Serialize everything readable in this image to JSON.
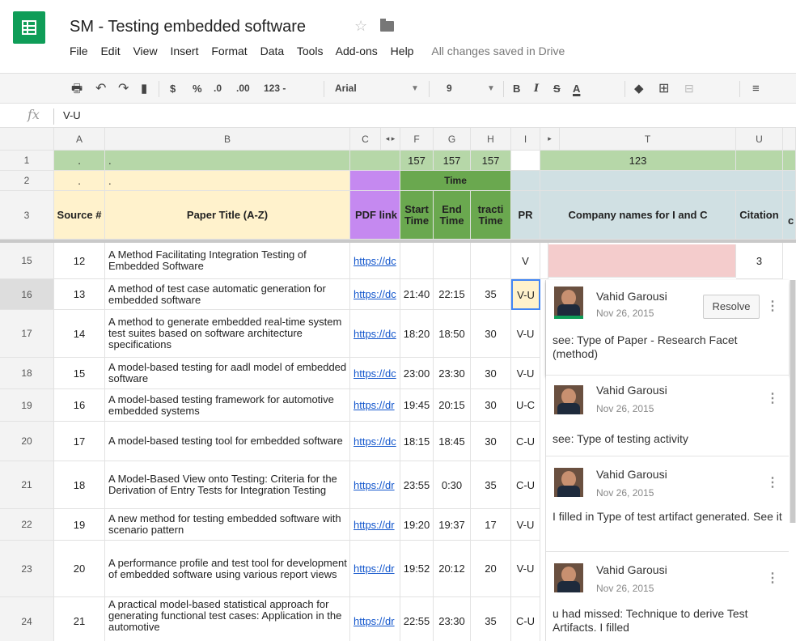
{
  "app": {
    "title": "SM - Testing embedded software",
    "saved_status": "All changes saved in Drive"
  },
  "menu": [
    "File",
    "Edit",
    "View",
    "Insert",
    "Format",
    "Data",
    "Tools",
    "Add-ons",
    "Help"
  ],
  "toolbar": {
    "currency": "$",
    "percent": "%",
    "dec_less": ".0",
    "dec_more": ".00",
    "number_format": "123 -",
    "font": "Arial",
    "font_size": "9",
    "bold": "B",
    "italic": "I",
    "strike": "S",
    "text_color": "A"
  },
  "formula_bar": {
    "fx": "fx",
    "value": "V-U"
  },
  "columns": [
    "A",
    "B",
    "C",
    "F",
    "G",
    "H",
    "I",
    "T",
    "U"
  ],
  "header_rows": {
    "row1": {
      "num": "1",
      "a": ".",
      "b": ".",
      "f": "157",
      "g": "157",
      "h": "157",
      "t": "123"
    },
    "row2": {
      "num": "2",
      "a": ".",
      "b": ".",
      "time": "Time"
    },
    "row3": {
      "num": "3",
      "a": "Source #",
      "b": "Paper Title (A-Z)",
      "c": "PDF link",
      "f": "Start Time",
      "g": "End Time",
      "h": "tracti Time",
      "i": "PR",
      "t": "Company names for I and C",
      "u": "Citation",
      "extra": "c"
    }
  },
  "rows": [
    {
      "num": "15",
      "a": "12",
      "b": "A Method Facilitating Integration Testing of Embedded Software",
      "c": "https://dc",
      "f": "",
      "g": "",
      "h": "",
      "i": "V",
      "u": "3"
    },
    {
      "num": "16",
      "a": "13",
      "b": "A method of test case automatic generation for embedded software",
      "c": "https://dc",
      "f": "21:40",
      "g": "22:15",
      "h": "35",
      "i": "V-U"
    },
    {
      "num": "17",
      "a": "14",
      "b": "A method to generate embedded real-time system test suites based on software architecture specifications",
      "c": "https://dc",
      "f": "18:20",
      "g": "18:50",
      "h": "30",
      "i": "V-U"
    },
    {
      "num": "18",
      "a": "15",
      "b": "A model-based testing for aadl model of embedded software",
      "c": "https://dc",
      "f": "23:00",
      "g": "23:30",
      "h": "30",
      "i": "V-U"
    },
    {
      "num": "19",
      "a": "16",
      "b": "A model-based testing framework for automotive embedded systems",
      "c": "https://dr",
      "f": "19:45",
      "g": "20:15",
      "h": "30",
      "i": "U-C"
    },
    {
      "num": "20",
      "a": "17",
      "b": "A model-based testing tool for embedded software",
      "c": "https://dc",
      "f": "18:15",
      "g": "18:45",
      "h": "30",
      "i": "C-U"
    },
    {
      "num": "21",
      "a": "18",
      "b": "A Model-Based View onto Testing: Criteria for the Derivation of Entry Tests for Integration Testing",
      "c": "https://dr",
      "f": "23:55",
      "g": "0:30",
      "h": "35",
      "i": "C-U"
    },
    {
      "num": "22",
      "a": "19",
      "b": "A new method for testing embedded software with scenario pattern",
      "c": "https://dr",
      "f": "19:20",
      "g": "19:37",
      "h": "17",
      "i": "V-U"
    },
    {
      "num": "23",
      "a": "20",
      "b": "A performance profile and test tool for development of embedded software using various report views",
      "c": "https://dr",
      "f": "19:52",
      "g": "20:12",
      "h": "20",
      "i": "V-U"
    },
    {
      "num": "24",
      "a": "21",
      "b": "A practical model-based statistical approach for generating functional test cases: Application in the automotive",
      "c": "https://dr",
      "f": "22:55",
      "g": "23:30",
      "h": "35",
      "i": "C-U"
    }
  ],
  "comments": [
    {
      "author": "Vahid Garousi",
      "date": "Nov 26, 2015",
      "text": "see: Type of Paper - Research Facet (method)",
      "resolve": "Resolve"
    },
    {
      "author": "Vahid Garousi",
      "date": "Nov 26, 2015",
      "text": "see: Type of testing activity"
    },
    {
      "author": "Vahid Garousi",
      "date": "Nov 26, 2015",
      "text": "I filled in Type of test artifact generated. See it"
    },
    {
      "author": "Vahid Garousi",
      "date": "Nov 26, 2015",
      "text": "u had missed: Technique to derive Test Artifacts. I filled"
    }
  ],
  "colors": {
    "brand": "#0f9d58",
    "green_header": "#b6d7a8",
    "green_time": "#6aa84f",
    "yellow_header": "#fff2cc",
    "purple_header": "#c589f0",
    "blue_header": "#d0e0e3",
    "pink_cell": "#f4cccc",
    "selected_cell": "#fff2cc"
  }
}
